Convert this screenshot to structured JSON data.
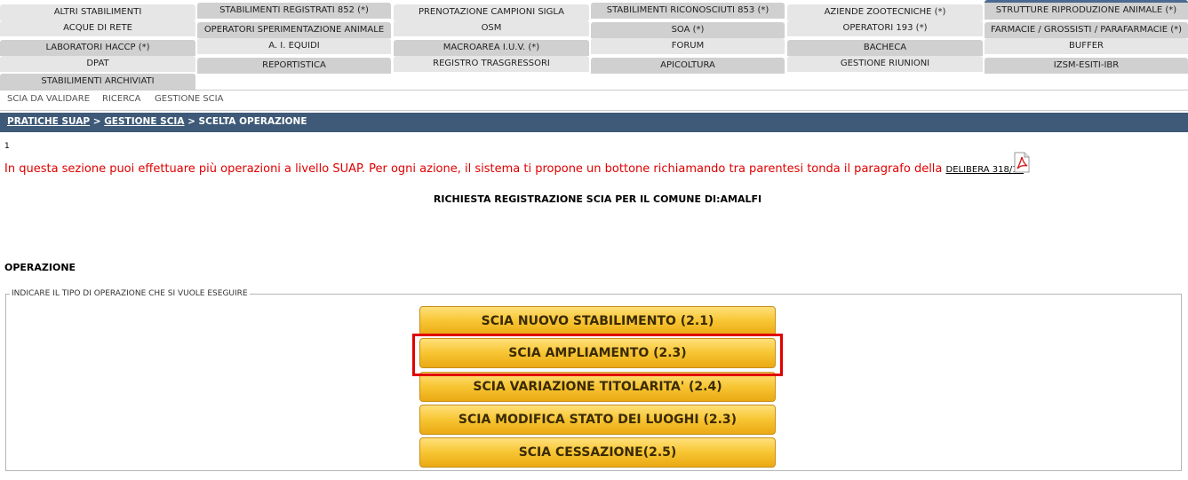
{
  "tabs_row1": [
    "ALTRI STABILIMENTI",
    "STABILIMENTI REGISTRATI 852 (*)",
    "PRENOTAZIONE CAMPIONI SIGLA",
    "STABILIMENTI RICONOSCIUTI 853 (*)",
    "AZIENDE ZOOTECNICHE (*)",
    "STRUTTURE RIPRODUZIONE ANIMALE (*)"
  ],
  "tabs_row2": [
    "ACQUE DI RETE",
    "OPERATORI SPERIMENTAZIONE ANIMALE",
    "OSM",
    "SOA (*)",
    "OPERATORI 193 (*)",
    "FARMACIE / GROSSISTI / PARAFARMACIE (*)"
  ],
  "tabs_row3": [
    "LABORATORI HACCP (*)",
    "A. I. EQUIDI",
    "MACROAREA I.U.V. (*)",
    "FORUM",
    "BACHECA",
    "BUFFER"
  ],
  "tabs_row4": [
    "DPAT",
    "REPORTISTICA",
    "REGISTRO TRASGRESSORI",
    "APICOLTURA",
    "GESTIONE RIUNIONI",
    "IZSM-ESITI-IBR"
  ],
  "tabs_row5": [
    "STABILIMENTI ARCHIVIATI"
  ],
  "subnav": [
    "SCIA DA VALIDARE",
    "RICERCA",
    "GESTIONE SCIA"
  ],
  "breadcrumb": {
    "crumb1": "PRATICHE SUAP",
    "sep1": " > ",
    "crumb2": "GESTIONE SCIA",
    "current": " > SCELTA OPERAZIONE"
  },
  "page_number": "1",
  "info_text": "In questa sezione puoi effettuare più operazioni a livello SUAP. Per ogni azione, il sistema ti propone un bottone richiamando tra parentesi tonda il paragrafo della ",
  "delibera_link": "DELIBERA 318/15",
  "richiesta_title": "RICHIESTA REGISTRAZIONE SCIA PER IL COMUNE DI:AMALFI",
  "operazione_heading": "OPERAZIONE",
  "fieldset_legend": "INDICARE IL TIPO DI OPERAZIONE CHE SI VUOLE ESEGUIRE",
  "operations": [
    "SCIA NUOVO STABILIMENTO (2.1)",
    "SCIA AMPLIAMENTO (2.3)",
    "SCIA VARIAZIONE TITOLARITA' (2.4)",
    "SCIA MODIFICA STATO DEI LUOGHI (2.3)",
    "SCIA CESSAZIONE(2.5)"
  ],
  "pdf_icon": "pdf-file-icon",
  "colors": {
    "breadcrumb_bg": "#3f5a78",
    "info_text": "#e00000",
    "button": "#f7c532",
    "highlight": "#e00000"
  }
}
